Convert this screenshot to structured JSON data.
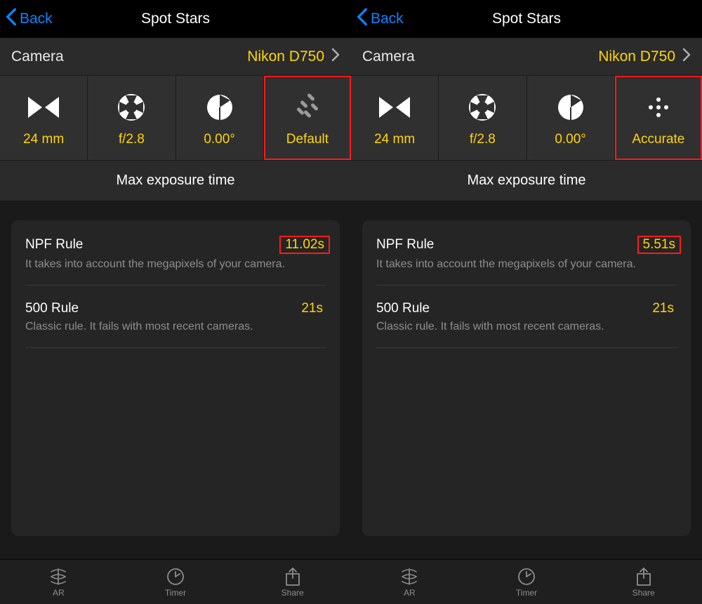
{
  "screens": [
    {
      "nav": {
        "back": "Back",
        "title": "Spot Stars"
      },
      "camera": {
        "label": "Camera",
        "value": "Nikon D750"
      },
      "settings": {
        "focal": "24 mm",
        "aperture": "f/2.8",
        "declination": "0.00°",
        "accuracy": "Default"
      },
      "section_header": "Max exposure time",
      "rules": {
        "npf": {
          "name": "NPF Rule",
          "value": "11.02s",
          "desc": "It takes into account the megapixels of your camera."
        },
        "r500": {
          "name": "500 Rule",
          "value": "21s",
          "desc": "Classic rule. It fails with most recent cameras."
        }
      },
      "tabs": {
        "ar": "AR",
        "timer": "Timer",
        "share": "Share"
      }
    },
    {
      "nav": {
        "back": "Back",
        "title": "Spot Stars"
      },
      "camera": {
        "label": "Camera",
        "value": "Nikon D750"
      },
      "settings": {
        "focal": "24 mm",
        "aperture": "f/2.8",
        "declination": "0.00°",
        "accuracy": "Accurate"
      },
      "section_header": "Max exposure time",
      "rules": {
        "npf": {
          "name": "NPF Rule",
          "value": "5.51s",
          "desc": "It takes into account the megapixels of your camera."
        },
        "r500": {
          "name": "500 Rule",
          "value": "21s",
          "desc": "Classic rule. It fails with most recent cameras."
        }
      },
      "tabs": {
        "ar": "AR",
        "timer": "Timer",
        "share": "Share"
      }
    }
  ],
  "colors": {
    "accent": "#ffd60a",
    "link": "#0a84ff",
    "highlight": "#ff1a1a"
  }
}
